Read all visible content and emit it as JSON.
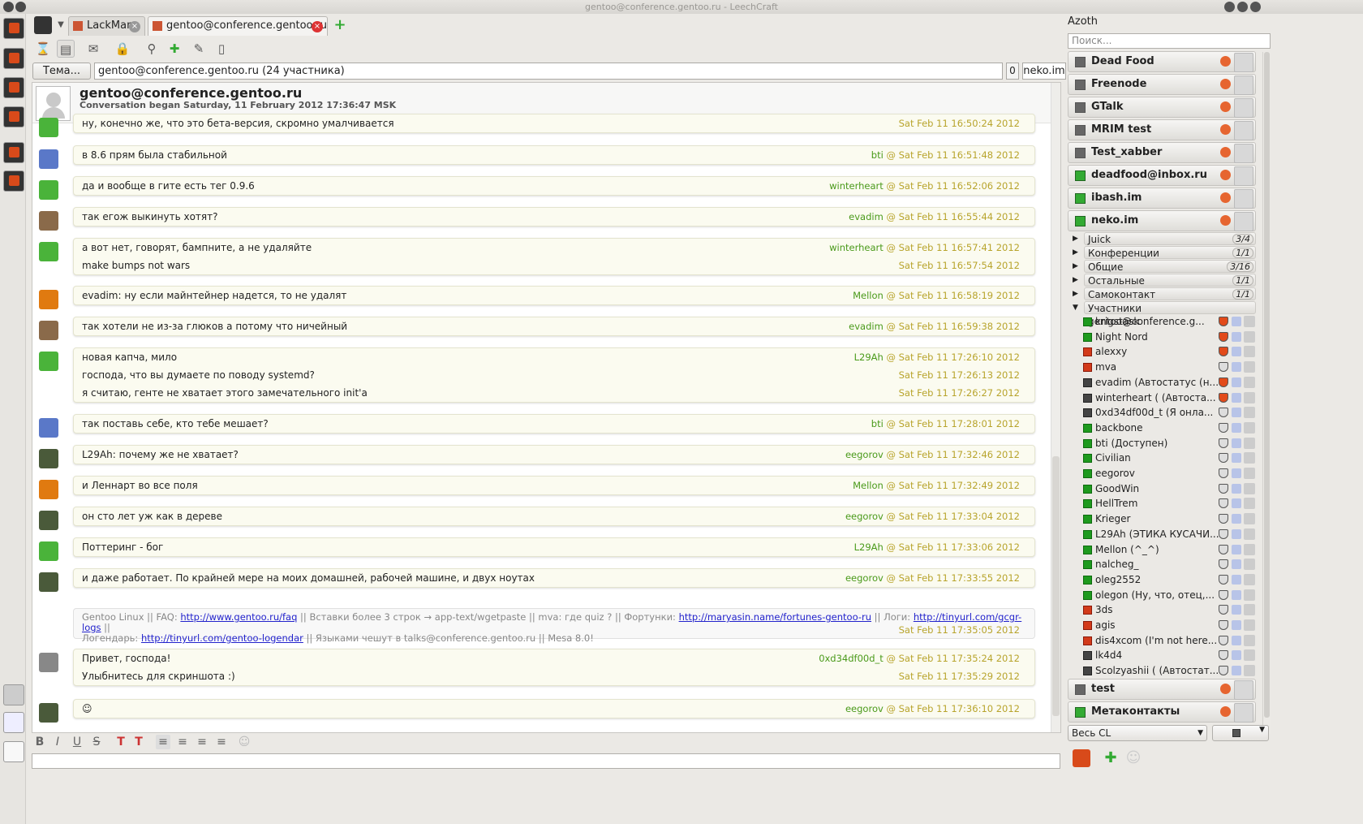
{
  "window": {
    "title": "gentoo@conference.gentoo.ru - LeechCraft"
  },
  "tabs": [
    {
      "label": "LackMan",
      "active": false
    },
    {
      "label": "gentoo@conference.gentoo.ru",
      "active": true
    }
  ],
  "topic": {
    "button_label": "Тема...",
    "field_value": "gentoo@conference.gentoo.ru (24 участника)",
    "count": "0",
    "nick": "neko.im"
  },
  "chat_header": {
    "room": "gentoo@conference.gentoo.ru",
    "subtitle": "Conversation began Saturday, 11 February 2012 17:36:47 MSK"
  },
  "messages": [
    {
      "avatar": "green-bird",
      "lines": [
        {
          "text": "ну, конечно же, что это бета-версия, скромно умалчивается",
          "nick": "",
          "time": "Sat Feb 11 16:50:24 2012"
        }
      ]
    },
    {
      "avatar": "blue-cat",
      "lines": [
        {
          "text": "в 8.6 прям была стабильной",
          "nick": "bti",
          "time": "Sat Feb 11 16:51:48 2012"
        }
      ]
    },
    {
      "avatar": "green-bird",
      "lines": [
        {
          "text": "да и вообще в гите есть тег 0.9.6",
          "nick": "winterheart",
          "time": "Sat Feb 11 16:52:06 2012"
        }
      ]
    },
    {
      "avatar": "man",
      "lines": [
        {
          "text": "так егож выкинуть хотят?",
          "nick": "evadim",
          "time": "Sat Feb 11 16:55:44 2012"
        }
      ]
    },
    {
      "avatar": "green-bird",
      "lines": [
        {
          "text": "а вот нет, говорят, бампните, а не удаляйте",
          "nick": "winterheart",
          "time": "Sat Feb 11 16:57:41 2012"
        },
        {
          "text": "make bumps not wars",
          "nick": "",
          "time": "Sat Feb 11 16:57:54 2012"
        }
      ]
    },
    {
      "avatar": "sun",
      "lines": [
        {
          "text": "evadim: ну если майнтейнер надется, то не удалят",
          "nick": "Mellon",
          "time": "Sat Feb 11 16:58:19 2012"
        }
      ]
    },
    {
      "avatar": "man",
      "lines": [
        {
          "text": "так хотели не из-за глюков а потому что ничейный",
          "nick": "evadim",
          "time": "Sat Feb 11 16:59:38 2012"
        }
      ]
    },
    {
      "avatar": "green-bird",
      "lines": [
        {
          "text": "новая капча, мило",
          "nick": "L29Ah",
          "time": "Sat Feb 11 17:26:10 2012"
        },
        {
          "text": "господа, что вы думаете по поводу systemd?",
          "nick": "",
          "time": "Sat Feb 11 17:26:13 2012"
        },
        {
          "text": "я считаю, генте не хватает этого замечательного init'a",
          "nick": "",
          "time": "Sat Feb 11 17:26:27 2012"
        }
      ]
    },
    {
      "avatar": "blue-cat",
      "lines": [
        {
          "text": "так поставь себе, кто тебе мешает?",
          "nick": "bti",
          "time": "Sat Feb 11 17:28:01 2012"
        }
      ]
    },
    {
      "avatar": "forest",
      "lines": [
        {
          "text": "L29Ah: почему же не хватает?",
          "nick": "eegorov",
          "time": "Sat Feb 11 17:32:46 2012"
        }
      ]
    },
    {
      "avatar": "sun",
      "lines": [
        {
          "text": "и Леннарт во все поля",
          "nick": "Mellon",
          "time": "Sat Feb 11 17:32:49 2012"
        }
      ]
    },
    {
      "avatar": "forest",
      "lines": [
        {
          "text": "он сто лет уж как в дереве",
          "nick": "eegorov",
          "time": "Sat Feb 11 17:33:04 2012"
        }
      ]
    },
    {
      "avatar": "green-bird",
      "lines": [
        {
          "text": "Поттеринг - бог",
          "nick": "L29Ah",
          "time": "Sat Feb 11 17:33:06 2012"
        }
      ]
    },
    {
      "avatar": "forest",
      "lines": [
        {
          "text": "и даже работает. По крайней мере на моих домашней, рабочей машине, и двух ноутах",
          "nick": "eegorov",
          "time": "Sat Feb 11 17:33:55 2012"
        }
      ]
    }
  ],
  "system_message": {
    "t1": "Gentoo Linux || FAQ: ",
    "l1": "http://www.gentoo.ru/faq",
    "t2": " || Вставки более 3 строк → app-text/wgetpaste || mva: где quiz ? || Фортунки: ",
    "l2": "http://maryasin.name/fortunes-gentoo-ru",
    "t3": " || Логи: ",
    "l3": "http://tinyurl.com/gcgr-logs",
    "t4": " ||",
    "t5": "Логендарь: ",
    "l4": "http://tinyurl.com/gentoo-logendar",
    "t6": " || Языками чешут в talks@conference.gentoo.ru || Mesa 8.0!",
    "time": "Sat Feb 11 17:35:05 2012"
  },
  "messages2": [
    {
      "avatar": "haskell",
      "lines": [
        {
          "text": "Привет, господа!",
          "nick": "0xd34df00d_t",
          "time": "Sat Feb 11 17:35:24 2012"
        },
        {
          "text": "Улыбнитесь для скриншота :)",
          "nick": "",
          "time": "Sat Feb 11 17:35:29 2012"
        }
      ]
    },
    {
      "avatar": "forest",
      "lines": [
        {
          "text": "☺",
          "nick": "eegorov",
          "time": "Sat Feb 11 17:36:10 2012"
        }
      ]
    }
  ],
  "azoth": {
    "title": "Azoth",
    "search_placeholder": "Поиск...",
    "accounts_top": [
      {
        "name": "Dead Food",
        "online": false
      },
      {
        "name": "Freenode",
        "online": false
      },
      {
        "name": "GTalk",
        "online": false
      },
      {
        "name": "MRIM test",
        "online": false
      },
      {
        "name": "Test_xabber",
        "online": false
      },
      {
        "name": "deadfood@inbox.ru",
        "online": true
      },
      {
        "name": "ibash.im",
        "online": true
      },
      {
        "name": "neko.im",
        "online": true
      }
    ],
    "groups": [
      {
        "name": "Juick",
        "count": "3/4",
        "expanded": false
      },
      {
        "name": "Конференции",
        "count": "1/1",
        "expanded": false
      },
      {
        "name": "Общие",
        "count": "3/16",
        "expanded": false
      },
      {
        "name": "Остальные",
        "count": "1/1",
        "expanded": false
      },
      {
        "name": "Самоконтакт",
        "count": "1/1",
        "expanded": false
      },
      {
        "name": "Участники gentoo@conference.g...",
        "count": "",
        "expanded": true
      }
    ],
    "members": [
      {
        "name": "krigstask",
        "status": "online",
        "role": "own"
      },
      {
        "name": "Night Nord",
        "status": "online",
        "role": "own"
      },
      {
        "name": "alexxy",
        "status": "dnd",
        "role": "own"
      },
      {
        "name": "mva",
        "status": "dnd",
        "role": "admin"
      },
      {
        "name": "evadim (Автостатус (н...",
        "status": "away",
        "role": "own"
      },
      {
        "name": "winterheart ( (Автоста...",
        "status": "away",
        "role": "own"
      },
      {
        "name": "0xd34df00d_t (Я онла...",
        "status": "away",
        "role": "none"
      },
      {
        "name": "backbone",
        "status": "online",
        "role": "member"
      },
      {
        "name": "bti (Доступен)",
        "status": "online",
        "role": "member"
      },
      {
        "name": "Civilian",
        "status": "online",
        "role": "member"
      },
      {
        "name": "eegorov",
        "status": "online",
        "role": "member"
      },
      {
        "name": "GoodWin",
        "status": "online",
        "role": "member"
      },
      {
        "name": "HellTrem",
        "status": "online",
        "role": "member"
      },
      {
        "name": "Krieger",
        "status": "online",
        "role": "member"
      },
      {
        "name": "L29Ah (ЭТИКА КУСАЧИ...",
        "status": "online",
        "role": "none"
      },
      {
        "name": "Mellon (^_^)",
        "status": "online",
        "role": "member"
      },
      {
        "name": "nalcheg_",
        "status": "online",
        "role": "member"
      },
      {
        "name": "oleg2552",
        "status": "online",
        "role": "member"
      },
      {
        "name": "olegon (Ну, что, отец,...",
        "status": "online",
        "role": "member"
      },
      {
        "name": "3ds",
        "status": "dnd",
        "role": "member"
      },
      {
        "name": "agis",
        "status": "dnd",
        "role": "member"
      },
      {
        "name": "dis4xcom (I'm not here...",
        "status": "dnd",
        "role": "member"
      },
      {
        "name": "lk4d4",
        "status": "away",
        "role": "member"
      },
      {
        "name": "Scolzyashii ( (Автостат...",
        "status": "away",
        "role": "member"
      }
    ],
    "accounts_bottom": [
      {
        "name": "test",
        "online": false
      },
      {
        "name": "Метаконтакты",
        "online": true
      }
    ],
    "filter_combo": "Весь CL"
  },
  "colors": {
    "timestamp": "#b8a42c",
    "nick": "#4a9a1a",
    "link": "#2222cc",
    "online": "#1e9a1e",
    "dnd": "#d23a1a"
  }
}
